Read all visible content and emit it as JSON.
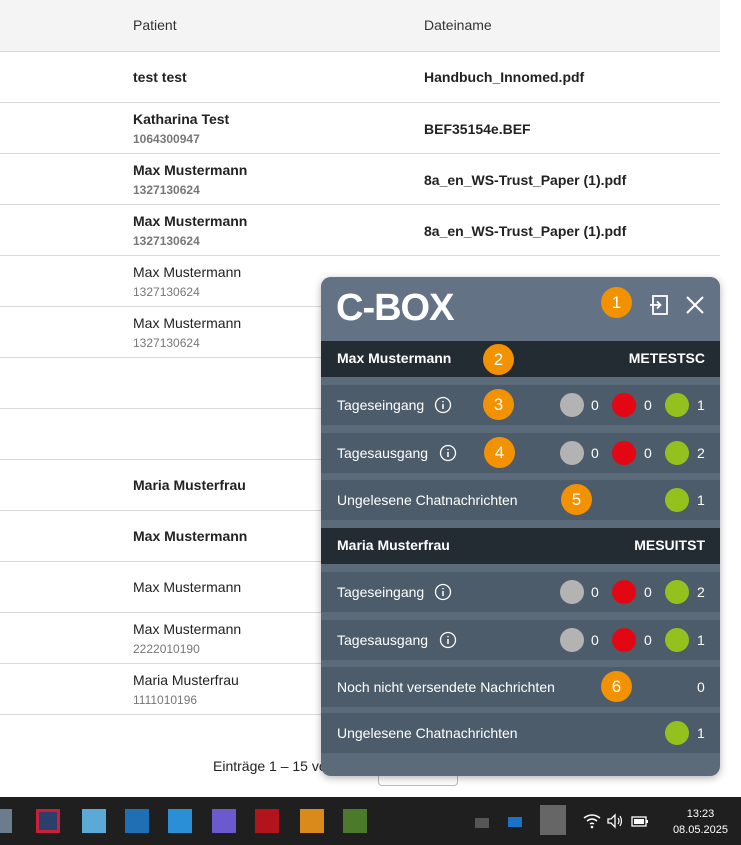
{
  "table": {
    "headers": {
      "patient": "Patient",
      "filename": "Dateiname"
    },
    "rows": [
      {
        "name": "test test",
        "id": "",
        "file": "Handbuch_Innomed.pdf",
        "bold": true
      },
      {
        "name": "Katharina Test",
        "id": "1064300947",
        "file": "BEF35154e.BEF",
        "bold": true
      },
      {
        "name": "Max Mustermann",
        "id": "1327130624",
        "file": "8a_en_WS-Trust_Paper (1).pdf",
        "bold": true
      },
      {
        "name": "Max Mustermann",
        "id": "1327130624",
        "file": "8a_en_WS-Trust_Paper (1).pdf",
        "bold": true
      },
      {
        "name": "Max Mustermann",
        "id": "1327130624",
        "file": "",
        "bold": false
      },
      {
        "name": "Max Mustermann",
        "id": "1327130624",
        "file": "",
        "bold": false
      },
      {
        "name": "",
        "id": "",
        "file": "",
        "bold": false
      },
      {
        "name": "",
        "id": "",
        "file": "",
        "bold": false
      },
      {
        "name": "Maria Musterfrau",
        "id": "",
        "file": "",
        "bold": true
      },
      {
        "name": "Max Mustermann",
        "id": "",
        "file": "",
        "bold": true
      },
      {
        "name": "Max Mustermann",
        "id": "",
        "file": "",
        "bold": false
      },
      {
        "name": "Max Mustermann",
        "id": "2222010190",
        "file": "",
        "bold": false
      },
      {
        "name": "Maria Musterfrau",
        "id": "1111010196",
        "file": "",
        "bold": false
      }
    ],
    "footer": "Einträge 1 – 15 vo"
  },
  "cbox": {
    "logo": "C-BOX",
    "badges": [
      "1",
      "2",
      "3",
      "4",
      "5",
      "6"
    ],
    "sections": [
      {
        "name": "Max Mustermann",
        "code": "METESTSC",
        "rows": [
          {
            "label": "Tageseingang",
            "grey": "0",
            "red": "0",
            "green": "1"
          },
          {
            "label": "Tagesausgang",
            "grey": "0",
            "red": "0",
            "green": "2"
          },
          {
            "label": "Ungelesene Chatnachrichten",
            "green": "1"
          }
        ]
      },
      {
        "name": "Maria Musterfrau",
        "code": "MESUITST",
        "rows": [
          {
            "label": "Tageseingang",
            "grey": "0",
            "red": "0",
            "green": "2"
          },
          {
            "label": "Tagesausgang",
            "grey": "0",
            "red": "0",
            "green": "1"
          },
          {
            "label": "Noch nicht versendete Nachrichten",
            "count": "0"
          },
          {
            "label": "Ungelesene Chatnachrichten",
            "green": "1"
          }
        ]
      }
    ],
    "colors": {
      "grey": "#b3b3b3",
      "red": "#e30613",
      "green": "#95c11f",
      "badge": "#f39200"
    }
  },
  "taskbar": {
    "time": "13:23",
    "date": "08.05.2025"
  }
}
